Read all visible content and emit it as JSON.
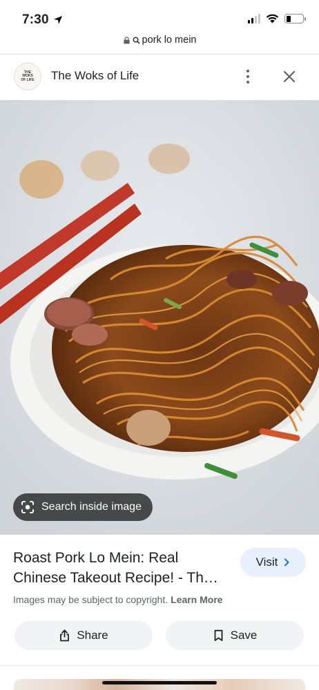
{
  "status_bar": {
    "time": "7:30",
    "icons": [
      "location-arrow-icon",
      "cellular-signal-icon",
      "wifi-icon",
      "battery-icon"
    ],
    "battery_level": 0.28
  },
  "url_bar": {
    "query": "pork lo mein",
    "icons": [
      "lock-icon",
      "search-icon"
    ]
  },
  "header": {
    "logo_text": "THE WOKS OF LIFE",
    "site_name": "The Woks of Life",
    "icons": [
      "more-vert-icon",
      "close-icon"
    ]
  },
  "image": {
    "subject": "pork lo mein in a white dish",
    "search_inside_label": "Search inside image",
    "search_icon": "lens-camera-icon"
  },
  "result": {
    "title": "Roast Pork Lo Mein: Real Chinese Takeout Recipe! - Th…",
    "visit_label": "Visit",
    "copyright_text": "Images may be subject to copyright.",
    "learn_more_label": "Learn More"
  },
  "actions": {
    "share_label": "Share",
    "save_label": "Save"
  },
  "colors": {
    "accent_visit_bg": "#e8f0fe",
    "chip_bg": "#f1f3f4",
    "text_primary": "#202124",
    "text_secondary": "#5f6368"
  }
}
